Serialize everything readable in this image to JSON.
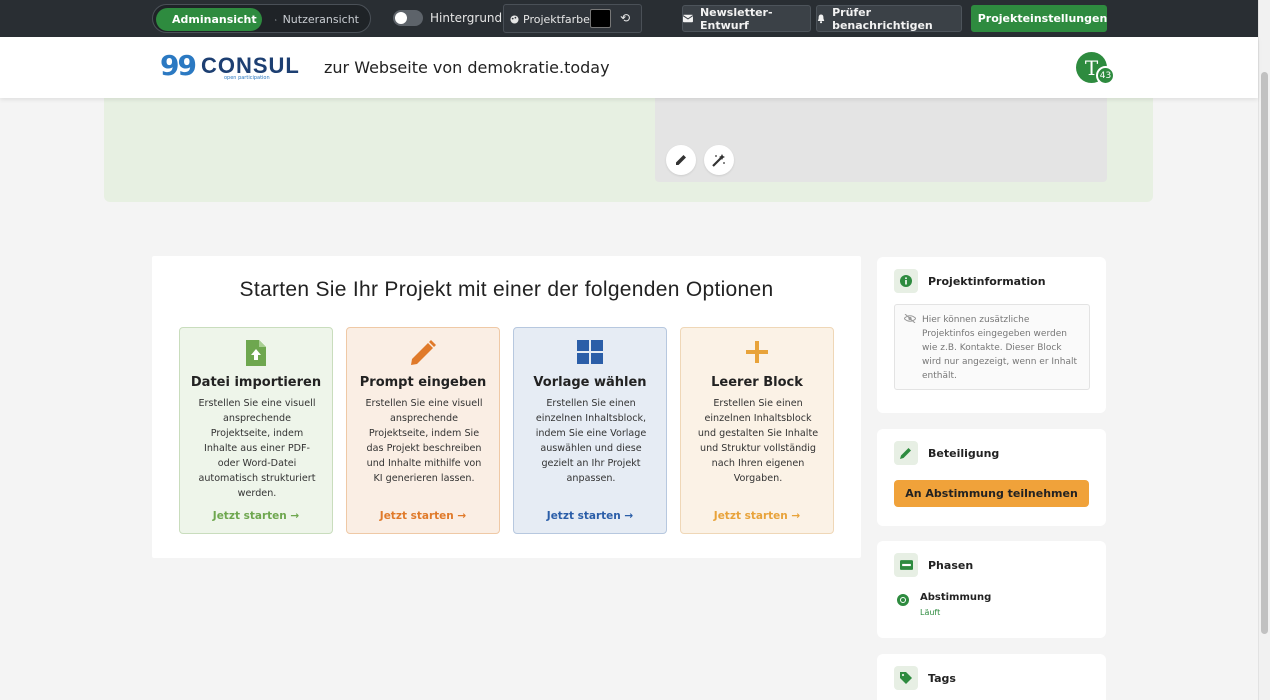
{
  "adminbar": {
    "view_toggle": {
      "admin_label": "Adminansicht",
      "user_label": "Nutzeransicht"
    },
    "background_label": "Hintergrund",
    "project_color_label": "Projektfarbe",
    "project_color": "#000000",
    "newsletter_label": "Newsletter-Entwurf",
    "notify_label": "Prüfer benachrichtigen",
    "settings_label": "Projekteinstellungen"
  },
  "header": {
    "logo_text": "CONSUL",
    "logo_sub": "open participation",
    "site_link": "zur Webseite von demokratie.today",
    "avatar_initial": "T",
    "avatar_badge": "43"
  },
  "main": {
    "title": "Starten Sie Ihr Projekt mit einer der folgenden Optionen",
    "options": [
      {
        "icon": "file-upload-icon",
        "title": "Datei importieren",
        "text": "Erstellen Sie eine visuell ansprechende Projektseite, indem Inhalte aus einer PDF- oder Word-Datei automatisch strukturiert werden.",
        "cta": "Jetzt starten →",
        "color": "#6ea74f"
      },
      {
        "icon": "pencil-icon",
        "title": "Prompt eingeben",
        "text": "Erstellen Sie eine visuell ansprechende Projektseite, indem Sie das Projekt beschreiben und Inhalte mithilfe von KI generieren lassen.",
        "cta": "Jetzt starten →",
        "color": "#e07a2a"
      },
      {
        "icon": "grid-icon",
        "title": "Vorlage wählen",
        "text": "Erstellen Sie einen einzelnen Inhaltsblock, indem Sie eine Vorlage auswählen und diese gezielt an Ihr Projekt anpassen.",
        "cta": "Jetzt starten →",
        "color": "#2b5ea8"
      },
      {
        "icon": "plus-icon",
        "title": "Leerer Block",
        "text": "Erstellen Sie einen einzelnen Inhaltsblock und gestalten Sie Inhalte und Struktur vollständig nach Ihren eigenen Vorgaben.",
        "cta": "Jetzt starten →",
        "color": "#e8a33a"
      }
    ]
  },
  "sidebar": {
    "project_info": {
      "title": "Projektinformation",
      "hint": "Hier können zusätzliche Projektinfos eingegeben werden wie z.B. Kontakte. Dieser Block wird nur angezeigt, wenn er Inhalt enthält."
    },
    "participation": {
      "title": "Beteiligung",
      "button": "An Abstimmung teilnehmen"
    },
    "phases": {
      "title": "Phasen",
      "items": [
        {
          "name": "Abstimmung",
          "status": "Läuft"
        }
      ]
    },
    "tags": {
      "title": "Tags"
    }
  }
}
